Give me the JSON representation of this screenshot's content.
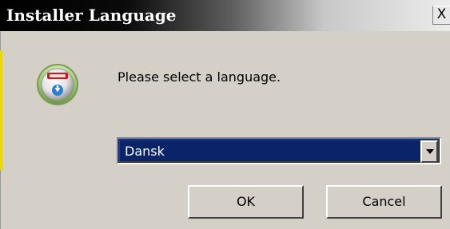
{
  "window": {
    "title": "Installer Language",
    "close_label": "X"
  },
  "dialog": {
    "icon": "installer-disc-icon",
    "prompt": "Please select a language.",
    "language_select": {
      "selected": "Dansk"
    },
    "buttons": {
      "ok": "OK",
      "cancel": "Cancel"
    }
  },
  "colors": {
    "titlebar_start": "#000000",
    "titlebar_end": "#ececec",
    "dialog_bg": "#d4d0c8",
    "selection_bg": "#0a246a",
    "accent_yellow": "#e8d800"
  }
}
